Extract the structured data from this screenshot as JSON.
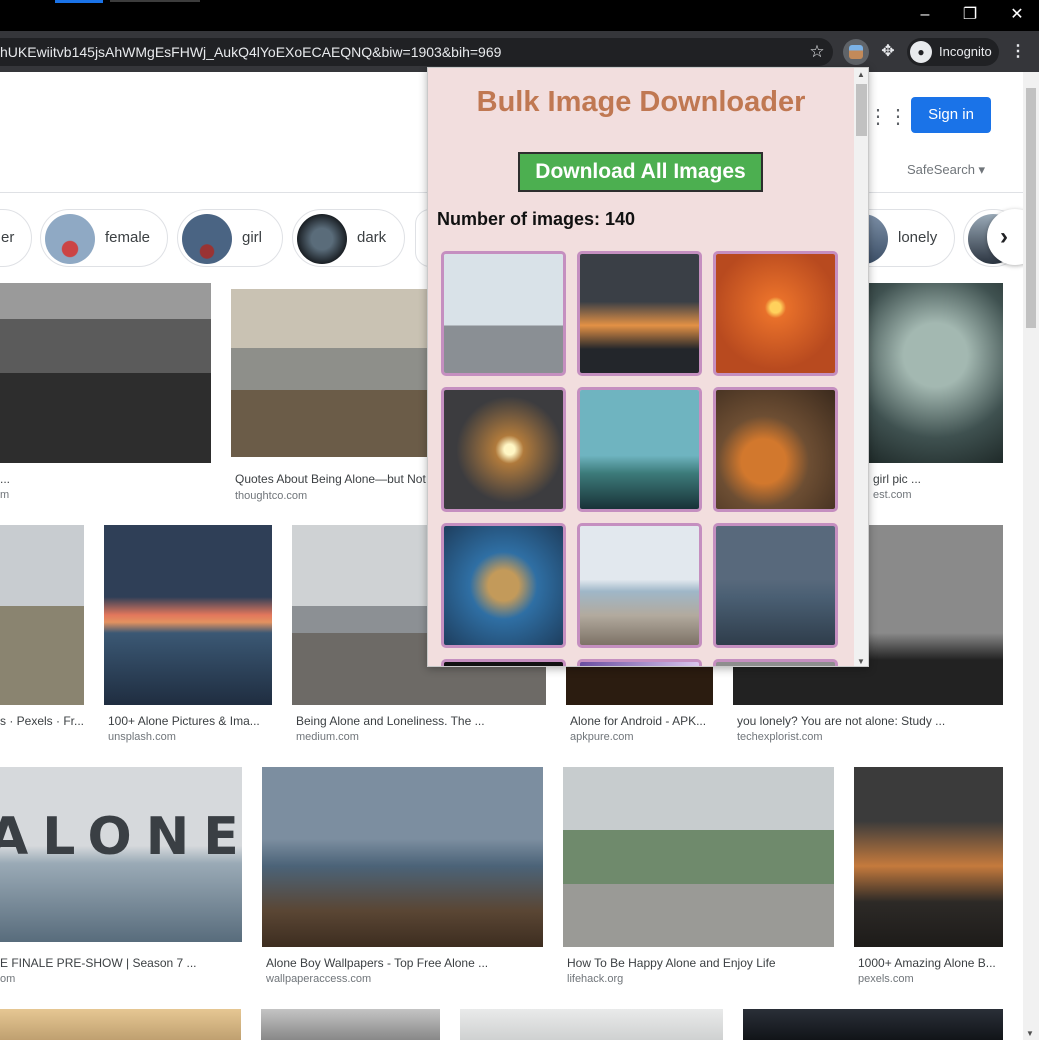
{
  "browser": {
    "url": "hUKEwiitvb145jsAhWMgEsFHWj_AukQ4lYoEXoECAEQNQ&biw=1903&bih=969",
    "incognito_label": "Incognito",
    "icons": [
      "minimize-icon",
      "restore-icon",
      "close-icon",
      "star-icon",
      "extension-icon",
      "puzzle-icon",
      "incognito-icon",
      "menu-icon"
    ]
  },
  "header": {
    "signin_label": "Sign in",
    "safesearch_label": "SafeSearch ▾"
  },
  "chips": [
    {
      "label": "er"
    },
    {
      "label": "female"
    },
    {
      "label": "girl"
    },
    {
      "label": "dark"
    },
    {
      "label": "lonely"
    }
  ],
  "results": [
    {
      "caption": "...",
      "source": "m"
    },
    {
      "caption": "Quotes About Being Alone—but Not",
      "source": "thoughtco.com"
    },
    {
      "caption": "girl pic ...",
      "source": "est.com"
    },
    {
      "caption": "s · Pexels · Fr...",
      "source": ""
    },
    {
      "caption": "100+ Alone Pictures & Ima...",
      "source": "unsplash.com"
    },
    {
      "caption": "Being Alone and Loneliness. The ...",
      "source": "medium.com"
    },
    {
      "caption": "Alone for Android - APK...",
      "source": "apkpure.com"
    },
    {
      "caption": "you lonely? You are not alone: Study ...",
      "source": "techexplorist.com"
    },
    {
      "caption": "E FINALE PRE-SHOW | Season 7 ...",
      "source": "om"
    },
    {
      "caption": "Alone Boy Wallpapers - Top Free Alone ...",
      "source": "wallpaperaccess.com"
    },
    {
      "caption": "How To Be Happy Alone and Enjoy Life",
      "source": "lifehack.org"
    },
    {
      "caption": "1000+ Amazing Alone B...",
      "source": "pexels.com"
    }
  ],
  "alone_overlay_text": "ALONE",
  "popup": {
    "title": "Bulk Image Downloader",
    "download_button": "Download All Images",
    "count_text": "Number of images: 140",
    "thumbnails": [
      "pier-fog",
      "boy-sunset",
      "girl-sea-sunset",
      "leaf-sun",
      "man-bench",
      "teddy-bear",
      "cardboard-robot",
      "girl-beach",
      "girl-boat-moon"
    ]
  },
  "colors": {
    "popup_bg": "#f2dede",
    "popup_title": "#c07852",
    "download_button_bg": "#4caf50",
    "thumb_border": "#c58fc0",
    "signin_bg": "#1a73e8"
  }
}
